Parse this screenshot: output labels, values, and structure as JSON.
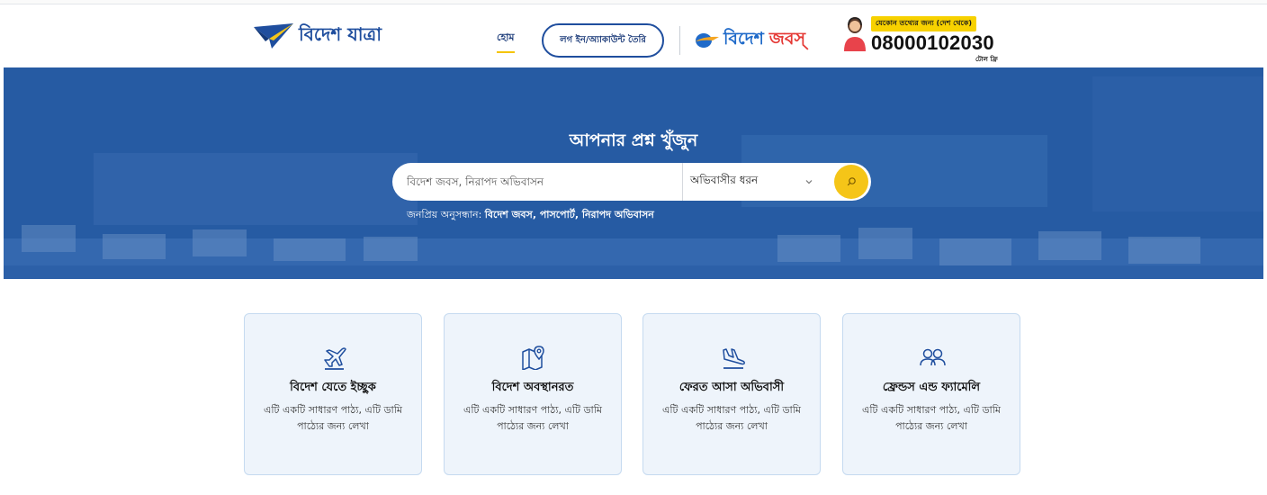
{
  "header": {
    "logo_text": "বিদেশ যাত্রা",
    "nav_home": "হোম",
    "login_button": "লগ ইন/অ্যাকাউন্ট তৈরি",
    "jobs_logo_word1": "বিদেশ",
    "jobs_logo_word2": "জবস্",
    "hotline_tag": "যেকোন তথ্যের জন্য (দেশ থেকে)",
    "hotline_number": "08000102030",
    "hotline_free": "টোল ফ্রি"
  },
  "hero": {
    "title": "আপনার প্রশ্ন খুঁজুন",
    "search_placeholder": "বিদেশ জবস, নিরাপদ অভিবাসন",
    "select_value": "অভিবাসীর ধরন",
    "popular_label": "জনপ্রিয় অনুসন্ধান:",
    "popular_items": "বিদেশ জবস, পাসপোর্ট, নিরাপদ অভিবাসন"
  },
  "cards": [
    {
      "icon": "plane-takeoff-icon",
      "title": "বিদেশ যেতে ইচ্ছুক",
      "desc": "এটি একটি সাধারণ পাঠ্য, এটি ডামি পাঠ্যের জন্য লেখা"
    },
    {
      "icon": "map-pin-icon",
      "title": "বিদেশ অবস্থানরত",
      "desc": "এটি একটি সাধারণ পাঠ্য, এটি ডামি পাঠ্যের জন্য লেখা"
    },
    {
      "icon": "plane-landing-icon",
      "title": "ফেরত আসা অভিবাসী",
      "desc": "এটি একটি সাধারণ পাঠ্য, এটি ডামি পাঠ্যের জন্য লেখা"
    },
    {
      "icon": "users-icon",
      "title": "ফ্রেন্ডস এন্ড ফ্যামেলি",
      "desc": "এটি একটি সাধারণ পাঠ্য, এটি ডামি পাঠ্যের জন্য লেখা"
    }
  ],
  "colors": {
    "brand_blue": "#1f4e9e",
    "hero_blue": "#265ba3",
    "accent_yellow": "#f5c518",
    "card_bg": "#eef4fb",
    "jobs_red": "#e53935"
  }
}
